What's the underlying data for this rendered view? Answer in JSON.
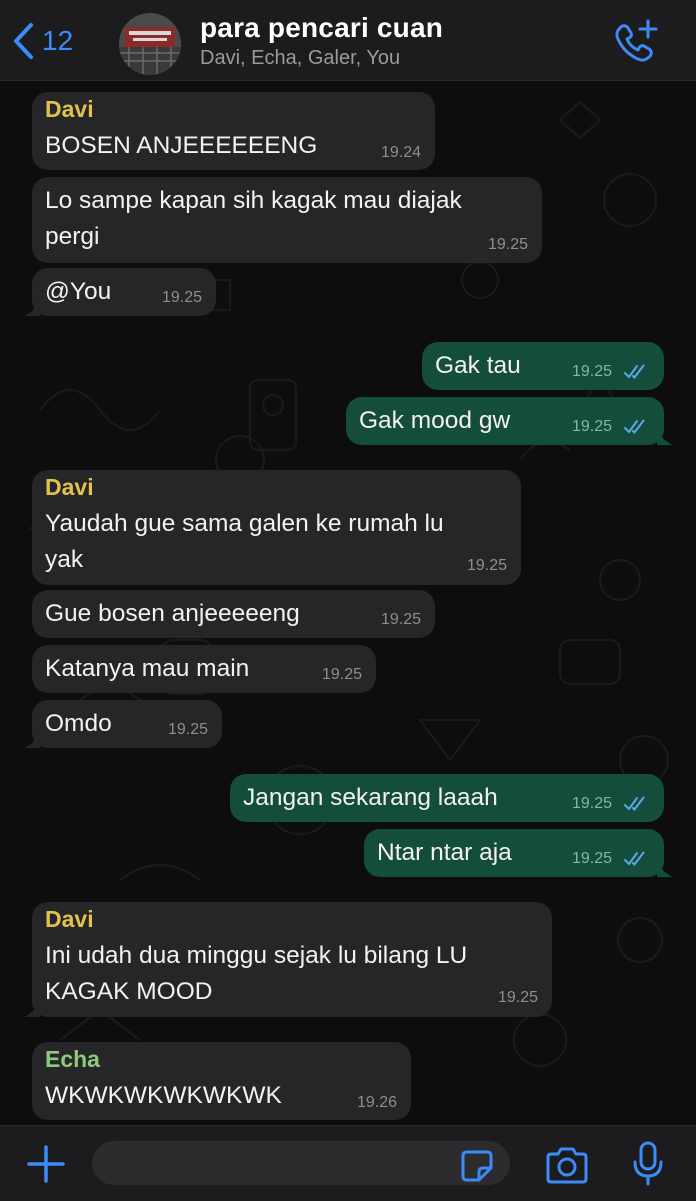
{
  "header": {
    "back_count": "12",
    "title": "para pencari cuan",
    "members": "Davi, Echa, Galer, You"
  },
  "colors": {
    "accent": "#3b8cf6",
    "incoming_bubble": "#262628",
    "outgoing_bubble": "#144d3c",
    "davi_name": "#e3c24a",
    "echa_name": "#8fc97a",
    "read_ticks": "#5aa9e6"
  },
  "messages": [
    {
      "sender": "Davi",
      "lines": [
        "BOSEN ANJEEEEEENG"
      ],
      "time": "19.24"
    },
    {
      "lines": [
        "Lo sampe kapan sih kagak mau diajak",
        "pergi"
      ],
      "time": "19.25"
    },
    {
      "lines": [
        "@You"
      ],
      "time": "19.25"
    },
    {
      "lines": [
        "Gak tau"
      ],
      "time": "19.25"
    },
    {
      "lines": [
        "Gak mood gw"
      ],
      "time": "19.25"
    },
    {
      "sender": "Davi",
      "lines": [
        "Yaudah gue sama galen ke rumah lu",
        "yak"
      ],
      "time": "19.25"
    },
    {
      "lines": [
        "Gue bosen anjeeeeeng"
      ],
      "time": "19.25"
    },
    {
      "lines": [
        "Katanya mau main"
      ],
      "time": "19.25"
    },
    {
      "lines": [
        "Omdo"
      ],
      "time": "19.25"
    },
    {
      "lines": [
        "Jangan sekarang laaah"
      ],
      "time": "19.25"
    },
    {
      "lines": [
        "Ntar ntar aja"
      ],
      "time": "19.25"
    },
    {
      "sender": "Davi",
      "lines": [
        "Ini udah dua minggu sejak lu bilang LU",
        "KAGAK MOOD"
      ],
      "time": "19.25"
    },
    {
      "sender": "Echa",
      "lines": [
        "WKWKWKWKWKWK"
      ],
      "time": "19.26"
    }
  ],
  "composer": {
    "placeholder": ""
  },
  "icons": {
    "back": "chevron-left-icon",
    "call": "phone-plus-icon",
    "attach": "plus-icon",
    "sticker": "sticker-icon",
    "camera": "camera-icon",
    "mic": "microphone-icon"
  }
}
